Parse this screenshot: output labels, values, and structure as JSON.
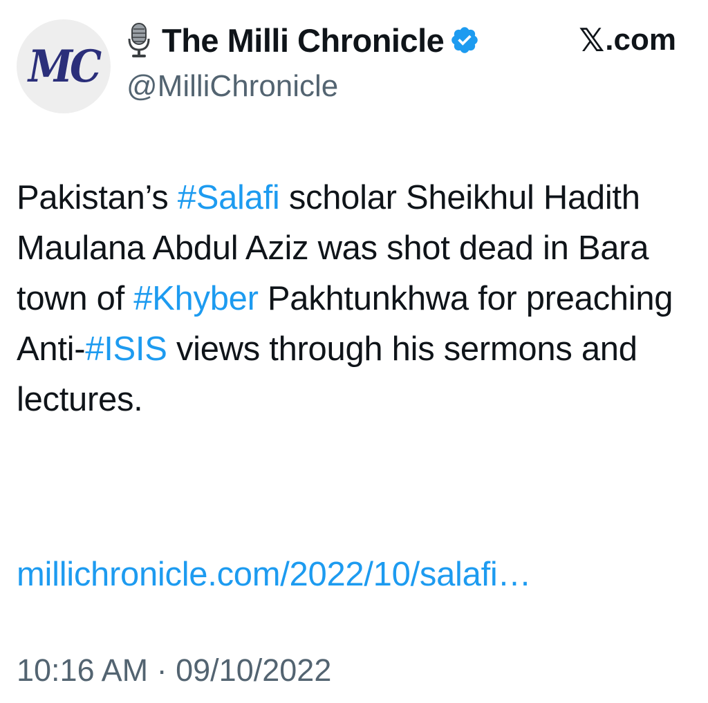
{
  "author": {
    "avatar_text": "MC",
    "display_name": "The Milli Chronicle",
    "handle": "@MilliChronicle",
    "verified": true,
    "icons": {
      "prefix": "microphone-icon",
      "verified": "verified-badge-icon"
    }
  },
  "source": {
    "logo": "𝕏",
    "text": ".com"
  },
  "tweet": {
    "segments": [
      {
        "text": "Pakistan’s ",
        "type": "text"
      },
      {
        "text": "#Salafi",
        "type": "hashtag"
      },
      {
        "text": " scholar Sheikhul Hadith Maulana Abdul Aziz was shot dead in Bara town of ",
        "type": "text"
      },
      {
        "text": "#Khyber",
        "type": "hashtag"
      },
      {
        "text": " Pakhtunkhwa for preaching Anti-",
        "type": "text"
      },
      {
        "text": "#ISIS",
        "type": "hashtag"
      },
      {
        "text": " views through his sermons and lectures.",
        "type": "text"
      }
    ],
    "link": "millichronicle.com/2022/10/salafi…",
    "timestamp": "10:16 AM · 09/10/2022"
  },
  "colors": {
    "link": "#1d9bf0",
    "text": "#0f1419",
    "muted": "#536471",
    "verified": "#1d9bf0",
    "avatar_text": "#2b2f7a"
  }
}
